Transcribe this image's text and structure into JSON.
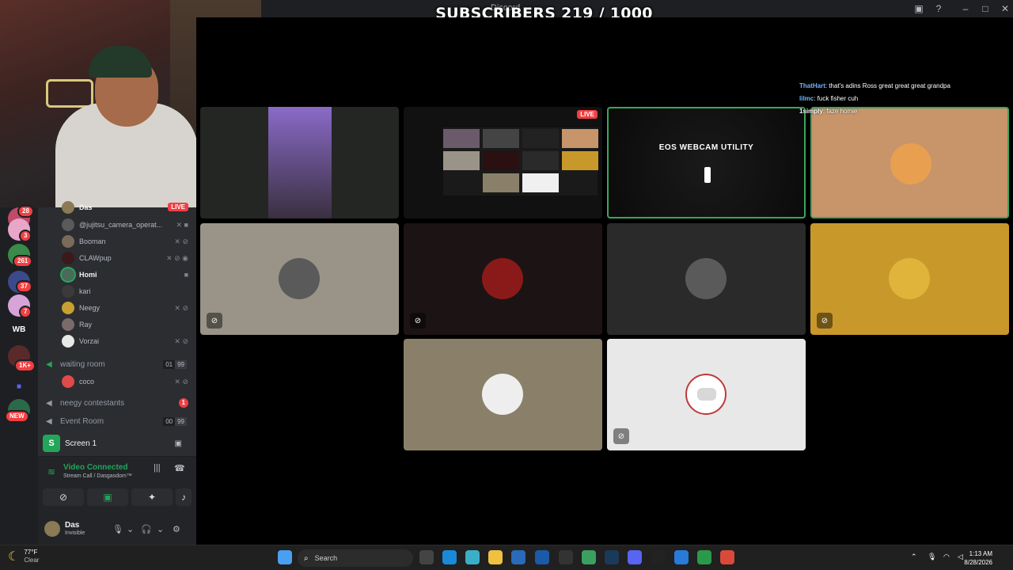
{
  "window": {
    "title": "Discord",
    "overlay_title": "SUBSCRIBERS 219 / 1000"
  },
  "titlebar_icons": {
    "inbox": "inbox-icon",
    "help": "?",
    "minimize": "–",
    "maximize": "□",
    "close": "✕"
  },
  "server_rail": {
    "items": [
      {
        "label": "",
        "badge": "28",
        "color": "#c04a6a"
      },
      {
        "label": "",
        "badge": "3",
        "color": "#e8a6c8"
      },
      {
        "label": "",
        "badge": "261",
        "color": "#3a8a4a"
      },
      {
        "label": "",
        "badge": "37",
        "color": "#3b4a8a"
      },
      {
        "label": "",
        "badge": "7",
        "color": "#d6a4d8"
      },
      {
        "label": "WB",
        "badge": "",
        "color": "#1e1f22"
      },
      {
        "label": "",
        "badge": "1K+",
        "color": "#5a2a2a"
      },
      {
        "label": "",
        "badge": "",
        "color": "#1e1f22"
      },
      {
        "label": "",
        "badge": "NEW",
        "color": "#2a6a4a"
      }
    ]
  },
  "voice_users": [
    {
      "name": "Das",
      "live": "LIVE",
      "icons": ""
    },
    {
      "name": "@jujitsu_camera_operat...",
      "icons": "✕ ■"
    },
    {
      "name": "Booman",
      "icons": "✕ ⊘"
    },
    {
      "name": "CLAWpup",
      "icons": "✕ ⊘ ◉"
    },
    {
      "name": "Homi",
      "icons": "■"
    },
    {
      "name": "kari",
      "icons": ""
    },
    {
      "name": "Neegy",
      "icons": "✕ ⊘"
    },
    {
      "name": "Ray",
      "icons": ""
    },
    {
      "name": "Vorzai",
      "icons": "✕ ⊘"
    }
  ],
  "channels": {
    "waiting_room": {
      "name": "waiting room",
      "count_a": "01",
      "count_b": "99"
    },
    "waiting_user": {
      "name": "coco",
      "icons": "✕ ⊘"
    },
    "neegy": {
      "name": "neegy contestants",
      "badge": "1"
    },
    "event_room": {
      "name": "Event Room",
      "count_a": "00",
      "count_b": "99"
    }
  },
  "screen_share": {
    "label": "Screen 1"
  },
  "voice": {
    "status": "Video Connected",
    "subtitle": "Stream Call / Dasgasdom™"
  },
  "user": {
    "name": "Das",
    "status": "Invisible"
  },
  "grid": {
    "live_label": "LIVE",
    "eos_label": "EOS WEBCAM UTILITY"
  },
  "chat": [
    {
      "user": "ThatHart",
      "text": ": that's adins Ross great great great grandpa"
    },
    {
      "user": "lilmc",
      "text": ": fuck fisher cuh"
    },
    {
      "user": "1simply",
      "text": ": faze homie"
    }
  ],
  "taskbar": {
    "weather_temp": "77°F",
    "weather_desc": "Clear",
    "search_placeholder": "Search",
    "time": "1:13 AM",
    "date": "8/28/2026"
  }
}
